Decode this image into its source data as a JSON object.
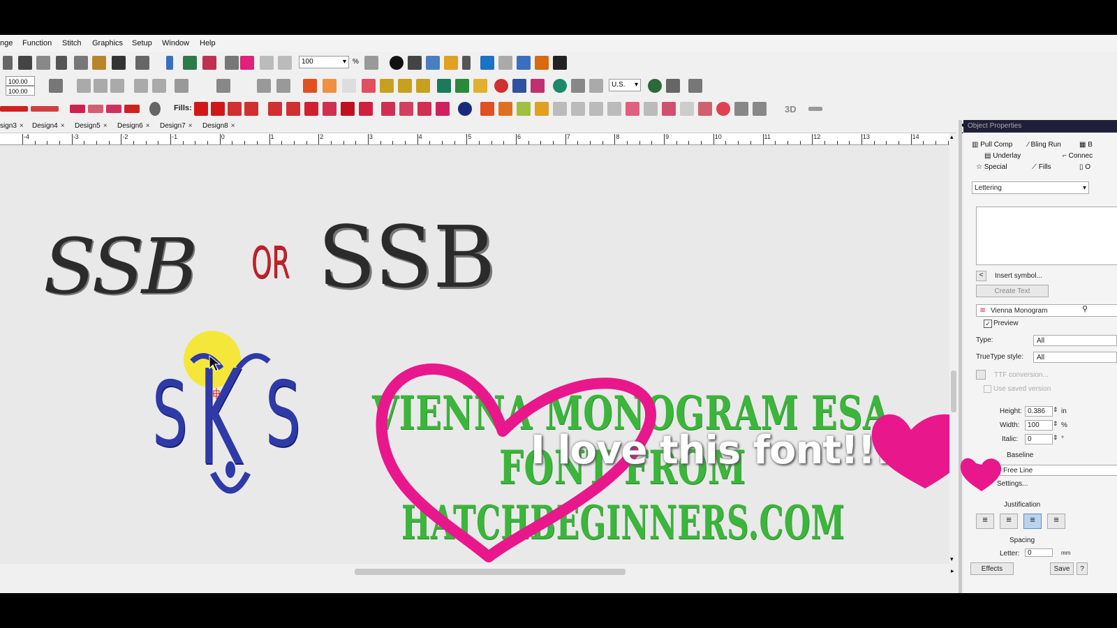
{
  "menu": [
    "nge",
    "Function",
    "Stitch",
    "Graphics",
    "Setup",
    "Window",
    "Help"
  ],
  "toolbar": {
    "zoom_value": "100",
    "zoom_unit": "%",
    "size_w": "100.00",
    "size_h": "100.00",
    "units_value": "U.S.",
    "fills_label": "Fills:",
    "three_d_label": "3D"
  },
  "tabs": [
    "sign3",
    "Design4",
    "Design5",
    "Design6",
    "Design7",
    "Design8"
  ],
  "ruler": [
    "-4",
    "-3",
    "-2",
    "-1",
    "0",
    "1",
    "2",
    "3",
    "4",
    "5",
    "6",
    "7",
    "8",
    "9",
    "10",
    "11",
    "12",
    "13",
    "14"
  ],
  "canvas": {
    "script_monogram": "SSB",
    "or_text": "OR",
    "block_monogram": "SSB",
    "vienna_left": "S",
    "vienna_middle": "K",
    "vienna_right": "S",
    "line1": "VIENNA MONOGRAM ESA",
    "line2": "FONT FROM",
    "line3": "HATCHBEGINNERS.COM",
    "overlay": "I love this font!!!"
  },
  "panel": {
    "title": "Object Properties",
    "tabs_row1": [
      "Pull Comp",
      "Bling Run",
      "B"
    ],
    "tabs_row2": [
      "Underlay",
      "Connec"
    ],
    "tabs_row3": [
      "Special",
      "Fills",
      "O"
    ],
    "object_type": "Lettering",
    "insert_symbol": "Insert symbol...",
    "create_text": "Create Text",
    "font_name": "Vienna Monogram",
    "preview_label": "Preview",
    "type_label": "Type:",
    "type_value": "All",
    "truetype_label": "TrueType style:",
    "truetype_value": "All",
    "ttf_label": "TTF conversion...",
    "saved_version_label": "Use saved version",
    "height_label": "Height:",
    "height_value": "0.386",
    "height_unit": "in",
    "width_label": "Width:",
    "width_value": "100",
    "width_unit": "%",
    "italic_label": "Italic:",
    "italic_value": "0",
    "italic_unit": "°",
    "baseline_label": "Baseline",
    "baseline_value": "Free Line",
    "settings_label": "Settings...",
    "justification_label": "Justification",
    "spacing_label": "Spacing",
    "letter_label": "Letter:",
    "letter_value": "0",
    "letter_unit": "mm",
    "effects_label": "Effects",
    "save_label": "Save",
    "help_label": "?"
  },
  "colors": {
    "accent_pink": "#e8188c",
    "text_green": "#3bb53b",
    "monogram_blue": "#2d3aa8",
    "or_red": "#c2212b",
    "cursor_highlight": "#f5e62a"
  }
}
